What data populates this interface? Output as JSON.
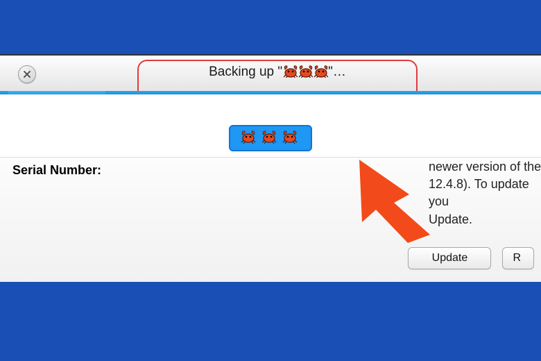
{
  "colors": {
    "backdrop": "#1a4fb5",
    "accent_blue": "#1f97f4",
    "annotation_red": "#e33a3a",
    "arrow_orange": "#f24a1a"
  },
  "titlebar": {
    "status_prefix": "Backing up \"",
    "status_suffix": "\"…",
    "device_icon": "crab-icon",
    "device_icon_count": 3
  },
  "device_tag": {
    "icon": "crab-icon",
    "icon_count": 3
  },
  "panel": {
    "serial_label": "Serial Number:",
    "info_line1_fragment": "newer version of the",
    "info_line2_fragment": "12.4.8). To update you",
    "info_line3_fragment": "Update."
  },
  "buttons": {
    "update": "Update",
    "restore_fragment": "R"
  }
}
